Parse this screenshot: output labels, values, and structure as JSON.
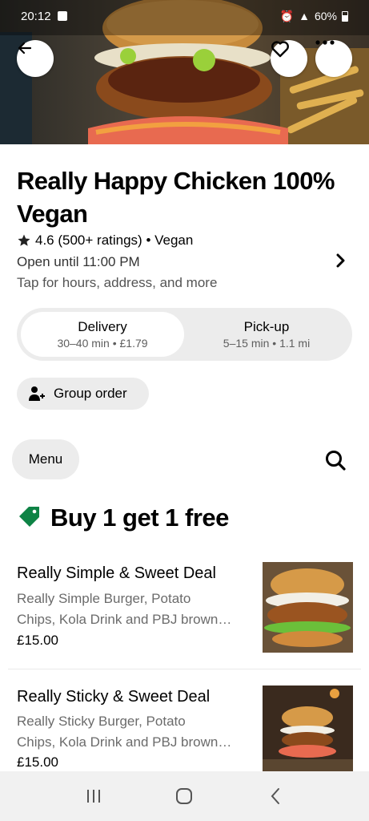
{
  "status_bar": {
    "time": "20:12",
    "battery": "60%"
  },
  "store": {
    "name": "Really Happy Chicken 100% Vegan",
    "rating": "4.6 (500+ ratings) • Vegan",
    "hours": "Open until 11:00 PM",
    "more_info": "Tap for hours, address, and more"
  },
  "modes": {
    "delivery": {
      "label": "Delivery",
      "detail": "30–40 min • £1.79"
    },
    "pickup": {
      "label": "Pick-up",
      "detail": "5–15 min • 1.1 mi"
    }
  },
  "group_order_label": "Group order",
  "menu_label": "Menu",
  "section": {
    "title": "Buy 1 get 1 free"
  },
  "items": [
    {
      "name": "Really Simple & Sweet Deal",
      "desc_line1": "Really Simple Burger, Potato",
      "desc_line2": "Chips, Kola Drink and PBJ brown…",
      "price": "£15.00"
    },
    {
      "name": "Really Sticky & Sweet Deal",
      "desc_line1": "Really Sticky Burger, Potato",
      "desc_line2": "Chips, Kola Drink and PBJ brown…",
      "price": "£15.00"
    }
  ],
  "icons": {
    "back": "arrow-left-icon",
    "favorite": "heart-icon",
    "more": "ellipsis-icon",
    "star": "star-icon",
    "chevron": "chevron-right-icon",
    "group": "add-person-icon",
    "search": "search-icon",
    "tag": "tag-icon"
  },
  "colors": {
    "accent_green": "#0e8345",
    "pill_bg": "#ececec"
  }
}
